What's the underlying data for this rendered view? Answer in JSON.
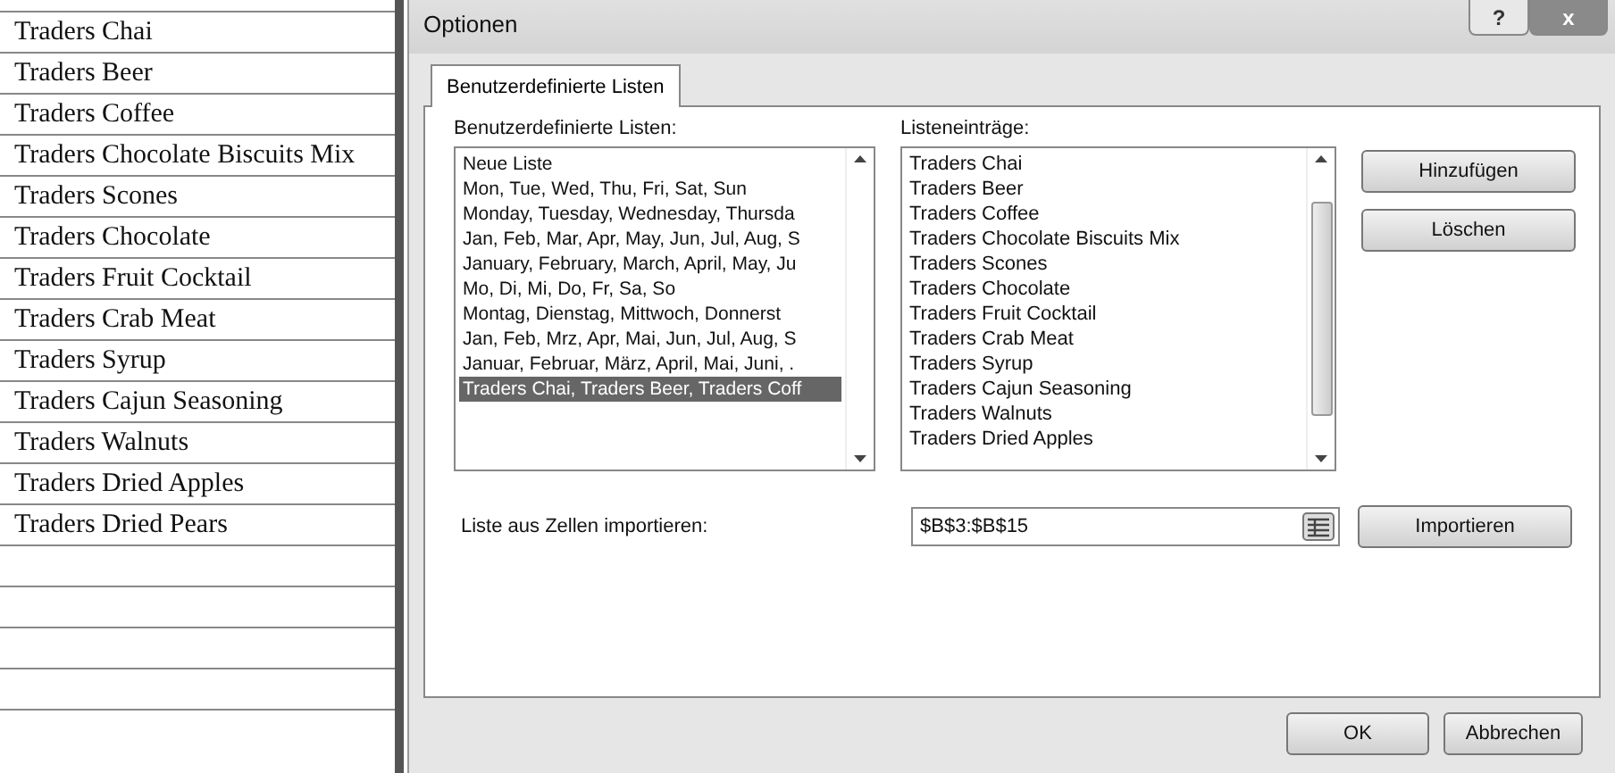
{
  "sheet": {
    "cells": [
      "Traders Chai",
      "Traders Beer",
      "Traders Coffee",
      "Traders Chocolate Biscuits Mix",
      "Traders Scones",
      "Traders Chocolate",
      "Traders Fruit Cocktail",
      "Traders Crab Meat",
      "Traders Syrup",
      "Traders Cajun Seasoning",
      "Traders Walnuts",
      "Traders Dried Apples",
      "Traders Dried Pears",
      "",
      "",
      "",
      "",
      ""
    ]
  },
  "window": {
    "title": "Optionen",
    "help_button": "?",
    "close_button": "x"
  },
  "tabs": [
    {
      "label": "Benutzerdefinierte Listen",
      "selected": true
    }
  ],
  "custom_lists": {
    "label": "Benutzerdefinierte Listen:",
    "items": [
      {
        "text": "Neue Liste",
        "selected": false
      },
      {
        "text": "Mon, Tue, Wed, Thu, Fri, Sat, Sun",
        "selected": false
      },
      {
        "text": "Monday, Tuesday, Wednesday, Thursda",
        "selected": false
      },
      {
        "text": "Jan, Feb, Mar, Apr, May, Jun, Jul, Aug, S",
        "selected": false
      },
      {
        "text": "January, February, March, April, May, Ju",
        "selected": false
      },
      {
        "text": "Mo, Di, Mi, Do, Fr, Sa, So",
        "selected": false
      },
      {
        "text": "Montag, Dienstag, Mittwoch, Donnerst",
        "selected": false
      },
      {
        "text": "Jan, Feb, Mrz, Apr, Mai, Jun, Jul, Aug, S",
        "selected": false
      },
      {
        "text": "Januar, Februar, März, April, Mai, Juni, .",
        "selected": false
      },
      {
        "text": "Traders Chai, Traders Beer, Traders Coff",
        "selected": true
      }
    ]
  },
  "list_entries": {
    "label": "Listeneinträge:",
    "items": [
      "Traders Chai",
      "Traders Beer",
      "Traders Coffee",
      "Traders Chocolate Biscuits Mix",
      "Traders Scones",
      "Traders Chocolate",
      "Traders Fruit Cocktail",
      "Traders Crab Meat",
      "Traders Syrup",
      "Traders Cajun Seasoning",
      "Traders Walnuts",
      "Traders Dried Apples"
    ]
  },
  "side_buttons": [
    "Hinzufügen",
    "Löschen"
  ],
  "import": {
    "label": "Liste aus Zellen importieren:",
    "value": "$B$3:$B$15",
    "button": "Importieren"
  },
  "buttons": [
    "OK",
    "Abbrechen"
  ]
}
